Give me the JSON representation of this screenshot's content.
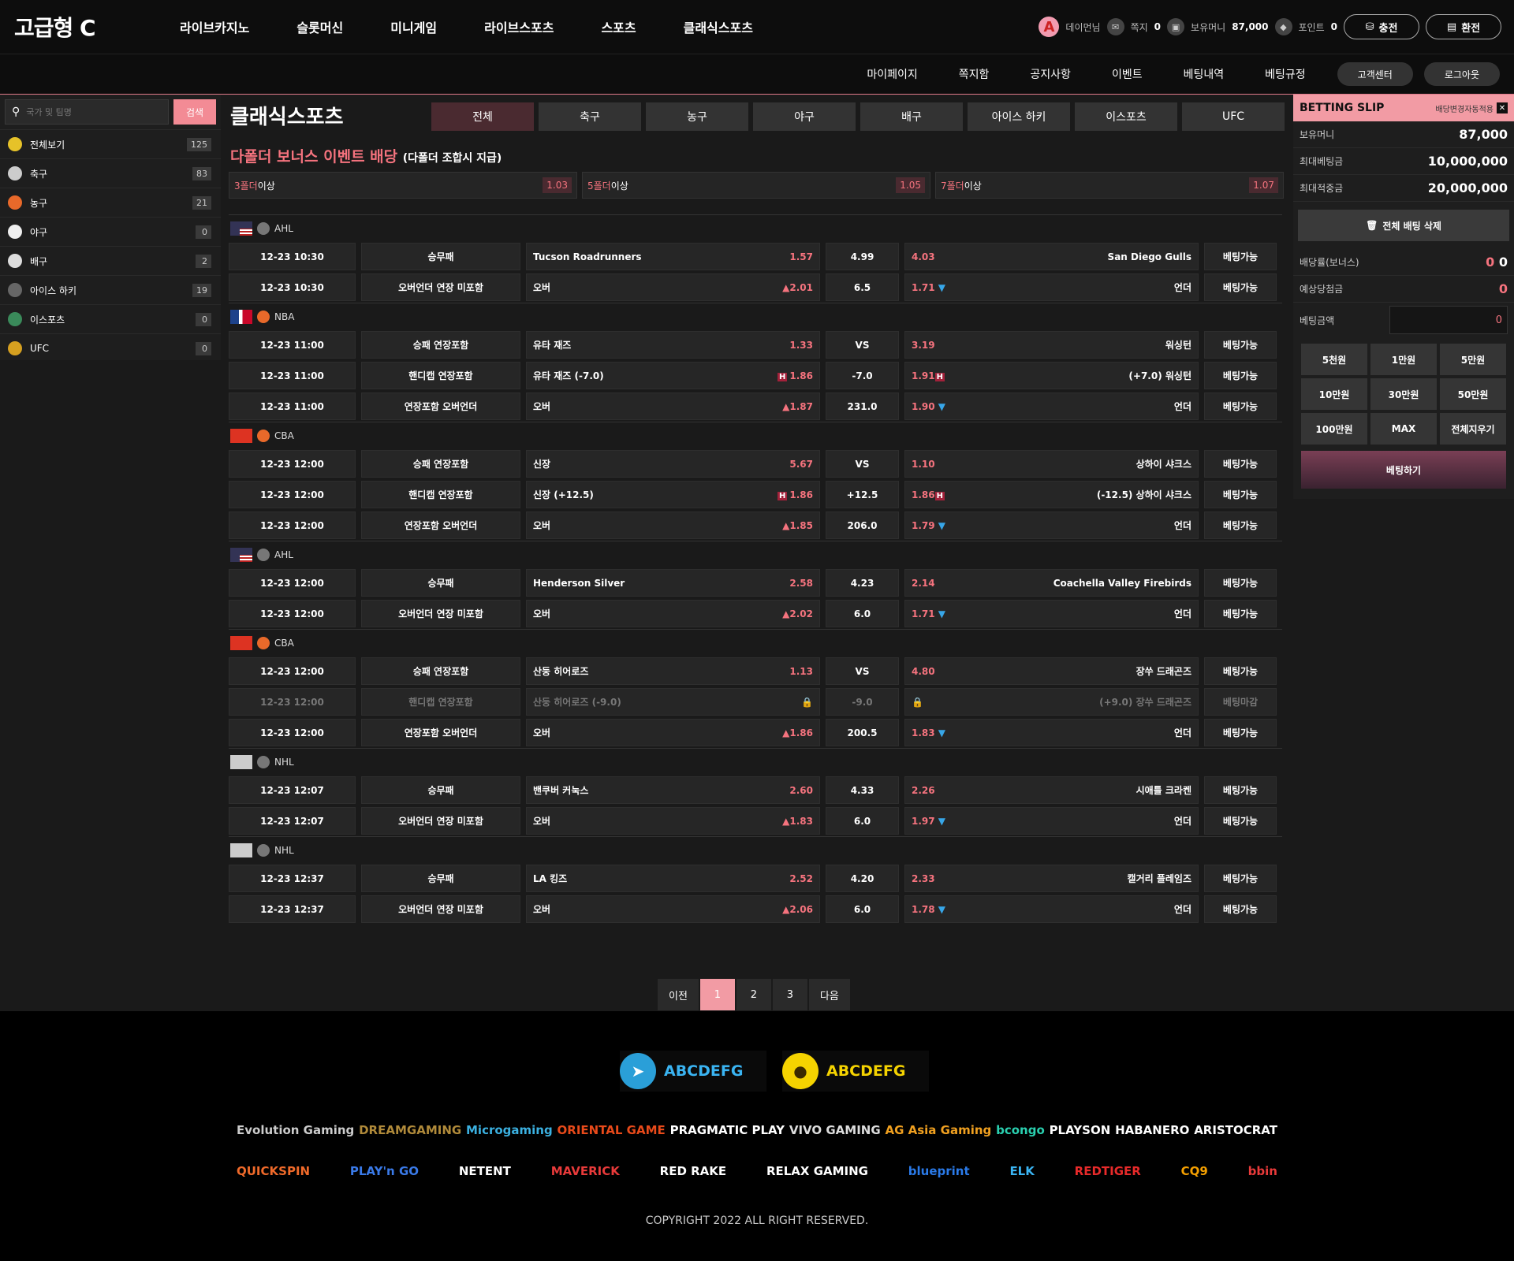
{
  "header": {
    "logo": "고급형 C",
    "nav": [
      "라이브카지노",
      "슬롯머신",
      "미니게임",
      "라이브스포츠",
      "스포츠",
      "클래식스포츠"
    ],
    "user": {
      "avatar": "A",
      "name": "데이먼님",
      "note_label": "쪽지",
      "note_count": "0",
      "money_label": "보유머니",
      "money": "87,000",
      "point_label": "포인트",
      "point": "0",
      "charge": "충전",
      "exchange": "환전"
    }
  },
  "subnav": {
    "links": [
      "마이페이지",
      "쪽지함",
      "공지사항",
      "이벤트",
      "베팅내역",
      "베팅규정"
    ],
    "buttons": [
      "고객센터",
      "로그아웃"
    ]
  },
  "sidebar": {
    "search_placeholder": "국가 및 팀명",
    "search_button": "검색",
    "sports": [
      {
        "label": "전체보기",
        "count": "125",
        "color": "#e6c229",
        "icon": "all-icon"
      },
      {
        "label": "축구",
        "count": "83",
        "color": "#ccc",
        "icon": "soccer-icon"
      },
      {
        "label": "농구",
        "count": "21",
        "color": "#e8692a",
        "icon": "basketball-icon"
      },
      {
        "label": "야구",
        "count": "0",
        "color": "#eee",
        "icon": "baseball-icon"
      },
      {
        "label": "배구",
        "count": "2",
        "color": "#ddd",
        "icon": "volleyball-icon"
      },
      {
        "label": "아이스 하키",
        "count": "19",
        "color": "#666",
        "icon": "hockey-icon"
      },
      {
        "label": "이스포츠",
        "count": "0",
        "color": "#3a8a5a",
        "icon": "esports-icon"
      },
      {
        "label": "UFC",
        "count": "0",
        "color": "#d6a020",
        "icon": "ufc-icon"
      }
    ]
  },
  "main": {
    "title": "클래식스포츠",
    "tabs": [
      "전체",
      "축구",
      "농구",
      "야구",
      "배구",
      "아이스 하키",
      "이스포츠",
      "UFC"
    ],
    "bonus_title": "다폴더 보너스 이벤트 배당",
    "bonus_sub": "(다폴더 조합시 지급)",
    "folds": [
      {
        "num": "3폴더",
        "suffix": "이상",
        "odds": "1.03"
      },
      {
        "num": "5폴더",
        "suffix": "이상",
        "odds": "1.05"
      },
      {
        "num": "7폴더",
        "suffix": "이상",
        "odds": "1.07"
      }
    ],
    "leagues": [
      {
        "flag": "us",
        "name": "AHL",
        "rows": [
          {
            "time": "12-23 10:30",
            "market": "승무패",
            "mclass": "mk-o",
            "home": "Tucson Roadrunners",
            "hodds": "1.57",
            "hmark": "",
            "mid": "4.99",
            "aodds": "4.03",
            "amark": "",
            "away": "San Diego Gulls",
            "status": "베팅가능"
          },
          {
            "time": "12-23 10:30",
            "market": "오버언더 연장 미포함",
            "mclass": "mk-y",
            "home": "오버",
            "hodds": "2.01",
            "hmark": "up",
            "mid": "6.5",
            "aodds": "1.71",
            "amark": "dn",
            "away": "언더",
            "status": "베팅가능"
          }
        ]
      },
      {
        "flag": "nba",
        "name": "NBA",
        "rows": [
          {
            "time": "12-23 11:00",
            "market": "승패 연장포함",
            "mclass": "mk-g",
            "home": "유타 재즈",
            "hodds": "1.33",
            "hmark": "",
            "mid": "VS",
            "aodds": "3.19",
            "amark": "",
            "away": "워싱턴",
            "status": "베팅가능"
          },
          {
            "time": "12-23 11:00",
            "market": "핸디캡 연장포함",
            "mclass": "mk-b",
            "home": "유타 재즈 (-7.0)",
            "hodds": "1.86",
            "hmark": "h",
            "mid": "-7.0",
            "aodds": "1.91",
            "amark": "h",
            "away": "(+7.0) 워싱턴",
            "status": "베팅가능"
          },
          {
            "time": "12-23 11:00",
            "market": "연장포함 오버언더",
            "mclass": "mk-y",
            "home": "오버",
            "hodds": "1.87",
            "hmark": "up",
            "mid": "231.0",
            "aodds": "1.90",
            "amark": "dn",
            "away": "언더",
            "status": "베팅가능"
          }
        ]
      },
      {
        "flag": "cn",
        "name": "CBA",
        "rows": [
          {
            "time": "12-23 12:00",
            "market": "승패 연장포함",
            "mclass": "mk-g",
            "home": "신장",
            "hodds": "5.67",
            "hmark": "",
            "mid": "VS",
            "aodds": "1.10",
            "amark": "",
            "away": "상하이 샤크스",
            "status": "베팅가능"
          },
          {
            "time": "12-23 12:00",
            "market": "핸디캡 연장포함",
            "mclass": "mk-b",
            "home": "신장 (+12.5)",
            "hodds": "1.86",
            "hmark": "h",
            "mid": "+12.5",
            "aodds": "1.86",
            "amark": "h",
            "away": "(-12.5) 상하이 샤크스",
            "status": "베팅가능"
          },
          {
            "time": "12-23 12:00",
            "market": "연장포함 오버언더",
            "mclass": "mk-y",
            "home": "오버",
            "hodds": "1.85",
            "hmark": "up",
            "mid": "206.0",
            "aodds": "1.79",
            "amark": "dn",
            "away": "언더",
            "status": "베팅가능"
          }
        ]
      },
      {
        "flag": "us",
        "name": "AHL",
        "rows": [
          {
            "time": "12-23 12:00",
            "market": "승무패",
            "mclass": "mk-o",
            "home": "Henderson Silver",
            "hodds": "2.58",
            "hmark": "",
            "mid": "4.23",
            "aodds": "2.14",
            "amark": "",
            "away": "Coachella Valley Firebirds",
            "status": "베팅가능"
          },
          {
            "time": "12-23 12:00",
            "market": "오버언더 연장 미포함",
            "mclass": "mk-y",
            "home": "오버",
            "hodds": "2.02",
            "hmark": "up",
            "mid": "6.0",
            "aodds": "1.71",
            "amark": "dn",
            "away": "언더",
            "status": "베팅가능"
          }
        ]
      },
      {
        "flag": "cn",
        "name": "CBA",
        "rows": [
          {
            "time": "12-23 12:00",
            "market": "승패 연장포함",
            "mclass": "mk-g",
            "home": "산둥 히어로즈",
            "hodds": "1.13",
            "hmark": "",
            "mid": "VS",
            "aodds": "4.80",
            "amark": "",
            "away": "장쑤 드래곤즈",
            "status": "베팅가능"
          },
          {
            "time": "12-23 12:00",
            "market": "핸디캡 연장포함",
            "mclass": "mk-b",
            "home": "산둥 히어로즈 (-9.0)",
            "hodds": "",
            "hmark": "lock",
            "mid": "-9.0",
            "aodds": "",
            "amark": "lock",
            "away": "(+9.0) 장쑤 드래곤즈",
            "status": "베팅마감",
            "disabled": true
          },
          {
            "time": "12-23 12:00",
            "market": "연장포함 오버언더",
            "mclass": "mk-y",
            "home": "오버",
            "hodds": "1.86",
            "hmark": "up",
            "mid": "200.5",
            "aodds": "1.83",
            "amark": "dn",
            "away": "언더",
            "status": "베팅가능"
          }
        ]
      },
      {
        "flag": "nhl",
        "name": "NHL",
        "rows": [
          {
            "time": "12-23 12:07",
            "market": "승무패",
            "mclass": "mk-o",
            "home": "밴쿠버 커눅스",
            "hodds": "2.60",
            "hmark": "",
            "mid": "4.33",
            "aodds": "2.26",
            "amark": "",
            "away": "시애틀 크라켄",
            "status": "베팅가능"
          },
          {
            "time": "12-23 12:07",
            "market": "오버언더 연장 미포함",
            "mclass": "mk-y",
            "home": "오버",
            "hodds": "1.83",
            "hmark": "up",
            "mid": "6.0",
            "aodds": "1.97",
            "amark": "dn",
            "away": "언더",
            "status": "베팅가능"
          }
        ]
      },
      {
        "flag": "nhl",
        "name": "NHL",
        "rows": [
          {
            "time": "12-23 12:37",
            "market": "승무패",
            "mclass": "mk-o",
            "home": "LA 킹즈",
            "hodds": "2.52",
            "hmark": "",
            "mid": "4.20",
            "aodds": "2.33",
            "amark": "",
            "away": "캘거리 플레임즈",
            "status": "베팅가능"
          },
          {
            "time": "12-23 12:37",
            "market": "오버언더 연장 미포함",
            "mclass": "mk-y",
            "home": "오버",
            "hodds": "2.06",
            "hmark": "up",
            "mid": "6.0",
            "aodds": "1.78",
            "amark": "dn",
            "away": "언더",
            "status": "베팅가능"
          }
        ]
      }
    ],
    "pager": {
      "prev": "이전",
      "pages": [
        "1",
        "2",
        "3"
      ],
      "current": "1",
      "next": "다음"
    }
  },
  "slip": {
    "title": "BETTING SLIP",
    "auto": "배당변경자동적용",
    "money_label": "보유머니",
    "money": "87,000",
    "max_bet_label": "최대베팅금",
    "max_bet": "10,000,000",
    "max_win_label": "최대적중금",
    "max_win": "20,000,000",
    "delete_all": "전체 배팅 삭제",
    "odds_label": "배당률(보너스)",
    "odds_val": "0",
    "odds_bonus": "0",
    "expected_label": "예상당첨금",
    "expected": "0",
    "amount_label": "베팅금액",
    "amount": "0",
    "chips": [
      "5천원",
      "1만원",
      "5만원",
      "10만원",
      "30만원",
      "50만원",
      "100만원",
      "MAX",
      "전체지우기"
    ],
    "bet_button": "베팅하기"
  },
  "footer": {
    "telegram": "ABCDEFG",
    "kakao": "ABCDEFG",
    "providers_row1": [
      "Evolution Gaming",
      "DREAMGAMING",
      "Microgaming",
      "ORIENTAL GAME",
      "PRAGMATIC PLAY",
      "VIVO GAMING",
      "AG Asia Gaming",
      "bcongo",
      "PLAYSON",
      "HABANERO",
      "ARISTOCRAT"
    ],
    "providers_row2": [
      "QUICKSPIN",
      "PLAY'n GO",
      "NETENT",
      "MAVERICK",
      "RED RAKE",
      "RELAX GAMING",
      "blueprint",
      "ELK",
      "REDTIGER",
      "CQ9",
      "bbin"
    ],
    "copyright": "COPYRIGHT 2022  ALL RIGHT RESERVED."
  }
}
